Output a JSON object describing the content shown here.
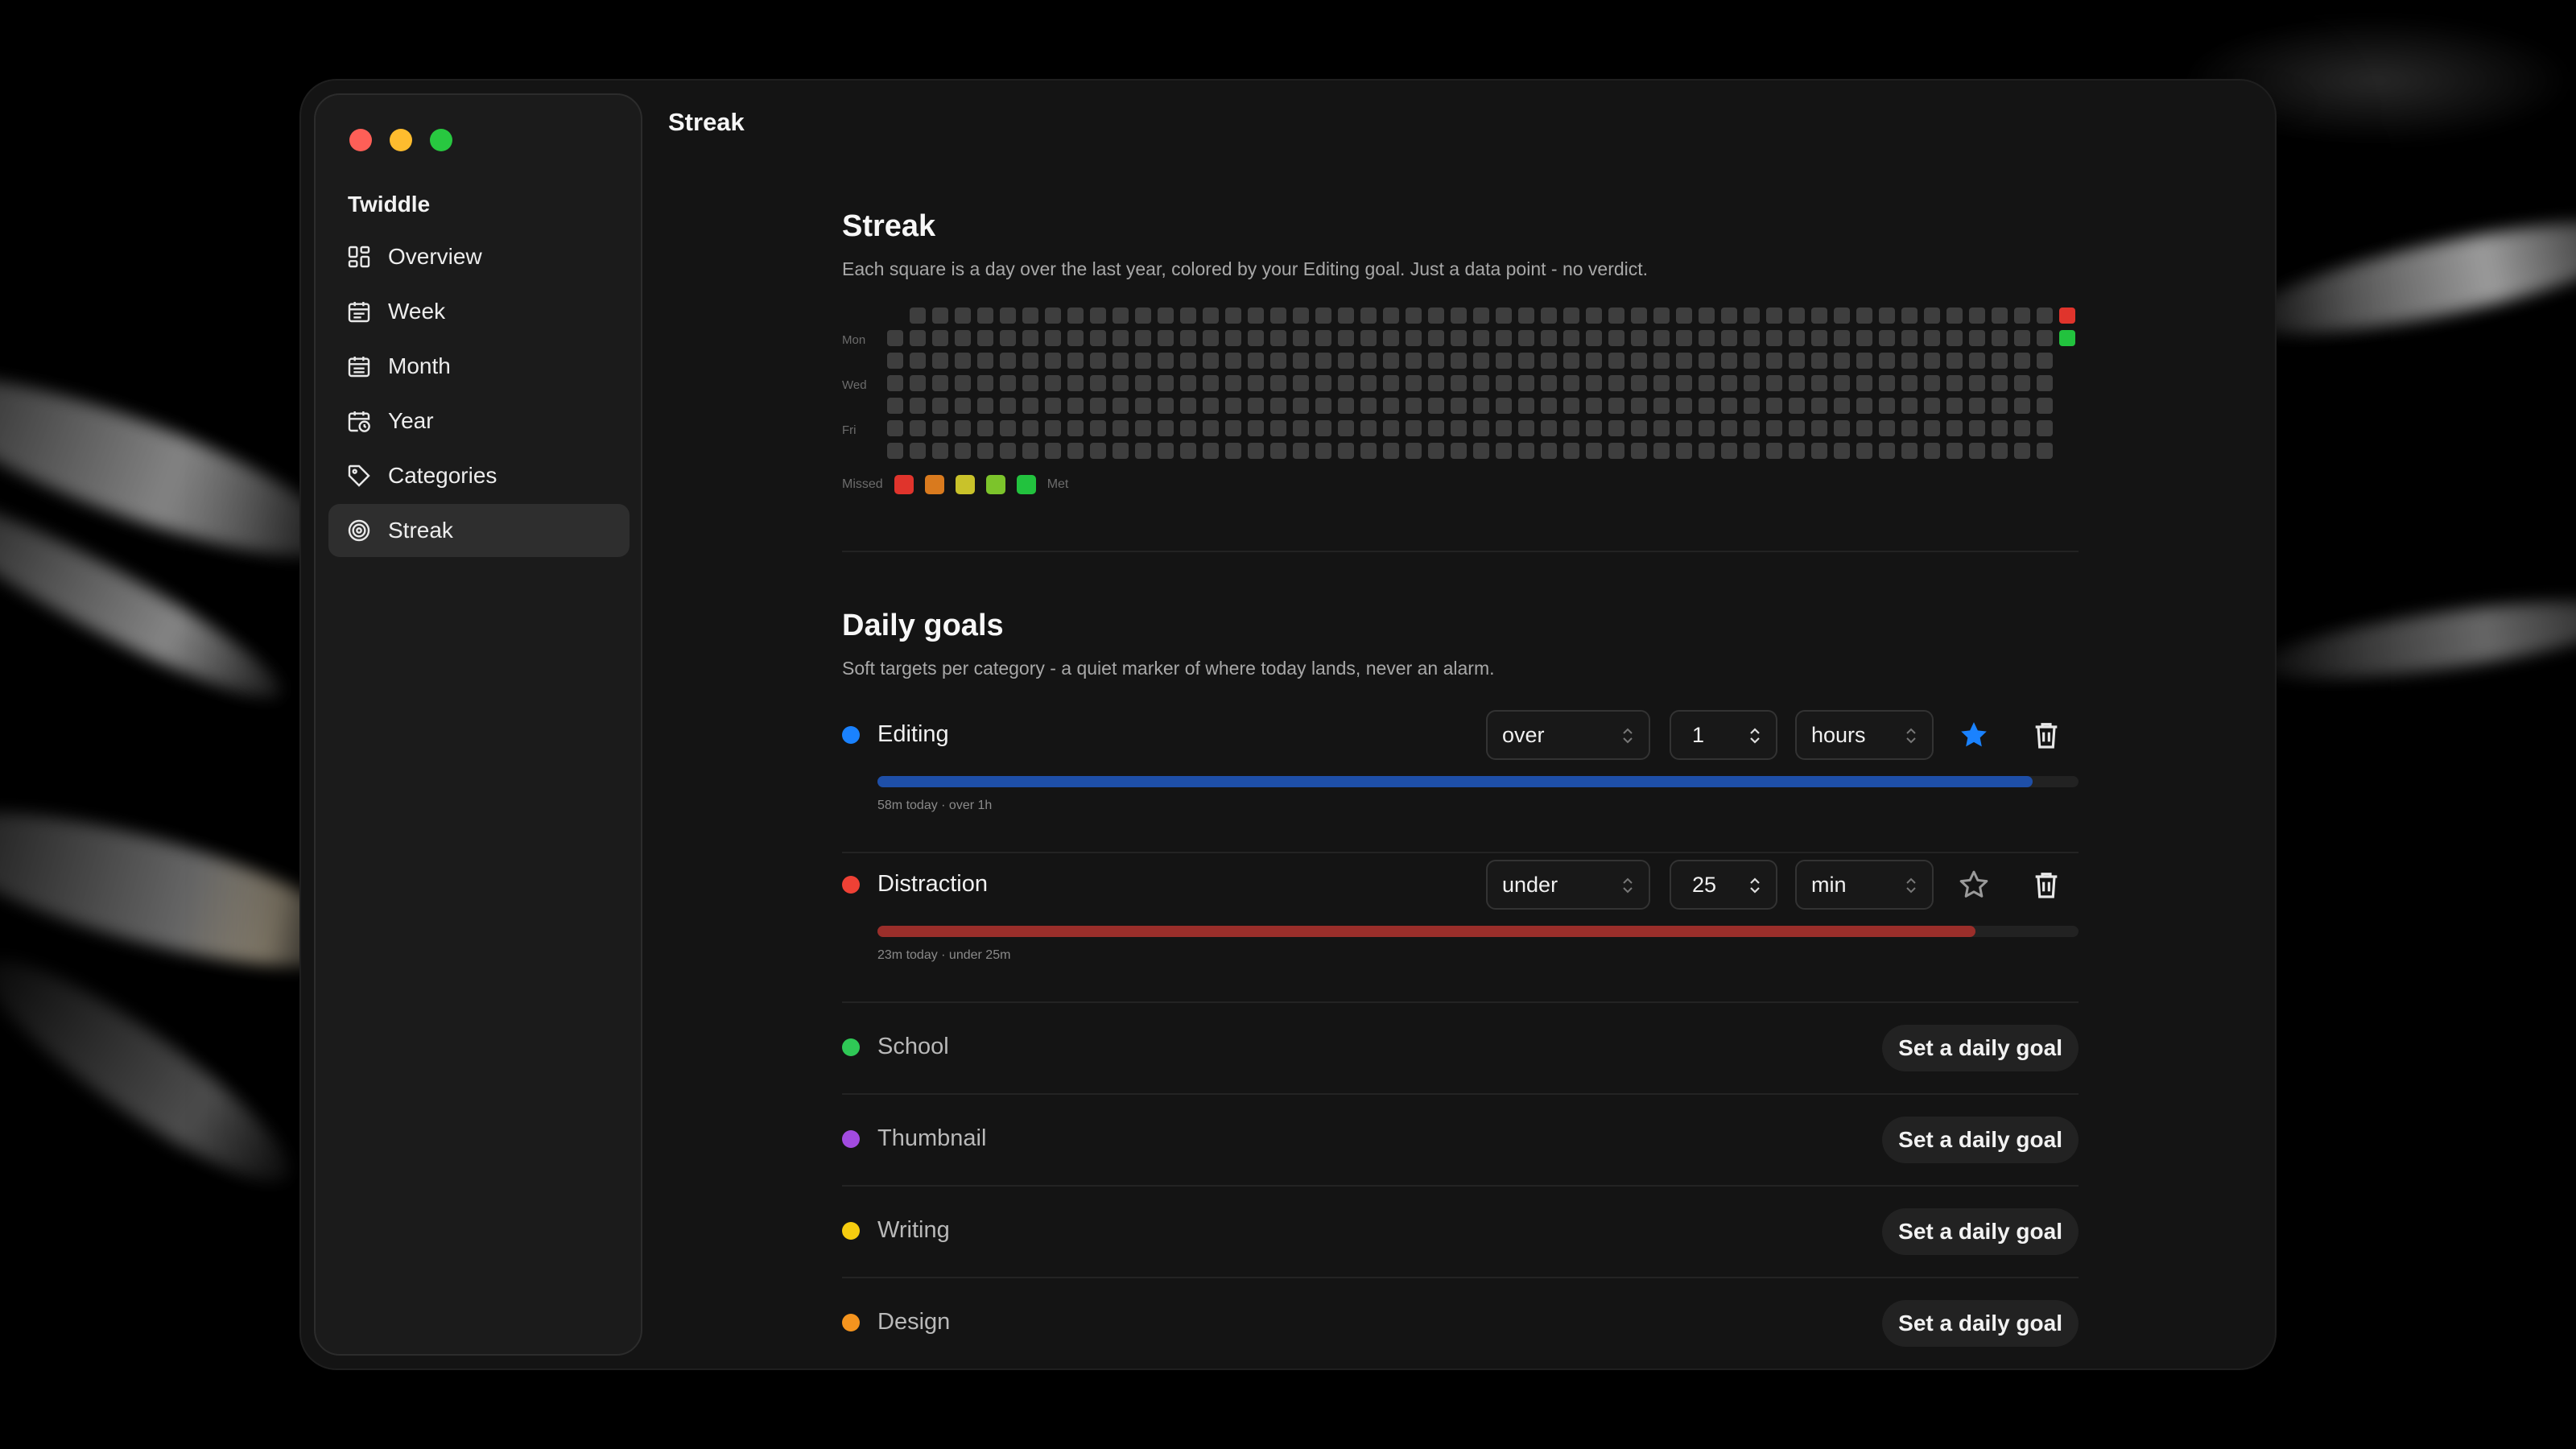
{
  "app": {
    "name": "Twiddle"
  },
  "window": {
    "title": "Streak"
  },
  "sidebar": {
    "items": [
      {
        "label": "Overview",
        "icon": "grid-icon"
      },
      {
        "label": "Week",
        "icon": "calendar-icon"
      },
      {
        "label": "Month",
        "icon": "calendar-icon"
      },
      {
        "label": "Year",
        "icon": "calendar-clock-icon"
      },
      {
        "label": "Categories",
        "icon": "tag-icon"
      },
      {
        "label": "Streak",
        "icon": "target-icon",
        "active": true
      }
    ]
  },
  "streak": {
    "heading": "Streak",
    "description": "Each square is a day over the last year, colored by your Editing goal. Just a data point - no verdict.",
    "day_labels": {
      "mon": "Mon",
      "wed": "Wed",
      "fri": "Fri"
    },
    "legend": {
      "missed": "Missed",
      "met": "Met",
      "colors": [
        "#e0342c",
        "#d97a1e",
        "#c9c22a",
        "#7cc42b",
        "#22c23e"
      ]
    },
    "empty_color": "#3e3e3e",
    "marked_days": [
      {
        "color": "#e0342c"
      },
      {
        "color": "#22c23e"
      }
    ]
  },
  "goals": {
    "heading": "Daily goals",
    "description": "Soft targets per category - a quiet marker of where today lands, never an alarm.",
    "set_label": "Set a daily goal",
    "items": [
      {
        "name": "Editing",
        "color": "#1a82ff",
        "mode": "over",
        "amount": "1",
        "unit": "hours",
        "starred": true,
        "progress": 0.962,
        "bar_color": "#1e4fa8",
        "caption": "58m today · over 1h"
      },
      {
        "name": "Distraction",
        "color": "#ef4135",
        "mode": "under",
        "amount": "25",
        "unit": "min",
        "starred": false,
        "progress": 0.914,
        "bar_color": "#9a2e2a",
        "caption": "23m today · under 25m"
      }
    ],
    "unset": [
      {
        "name": "School",
        "color": "#2fc856"
      },
      {
        "name": "Thumbnail",
        "color": "#a24be0"
      },
      {
        "name": "Writing",
        "color": "#f5cc0f"
      },
      {
        "name": "Design",
        "color": "#f5941e"
      }
    ]
  }
}
